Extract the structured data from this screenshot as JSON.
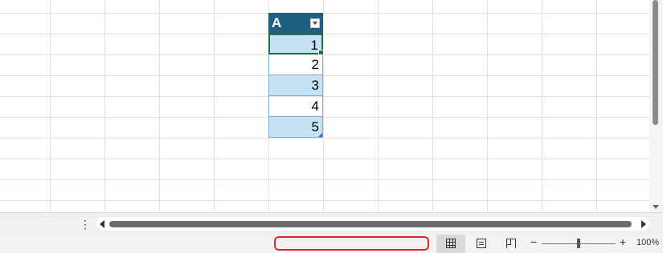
{
  "table": {
    "header": "A",
    "values": [
      "1",
      "2",
      "3",
      "4",
      "5"
    ]
  },
  "sheet_bar": {
    "menu_icon": "more-vertical-icon"
  },
  "status_bar": {
    "status_text": "",
    "view_icons": [
      "normal-view-icon",
      "page-layout-icon",
      "page-break-preview-icon"
    ],
    "zoom_minus": "−",
    "zoom_plus": "+",
    "zoom_level": "100%"
  }
}
